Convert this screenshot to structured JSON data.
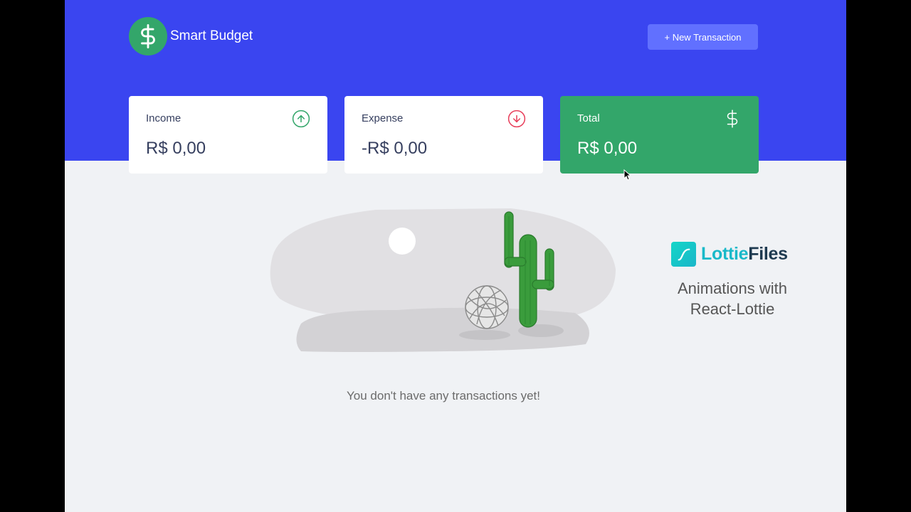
{
  "app": {
    "name": "Smart Budget",
    "logo_icon": "dollar-icon"
  },
  "header": {
    "new_transaction_label": "+ New Transaction"
  },
  "summary": {
    "income": {
      "label": "Income",
      "value": "R$ 0,00",
      "icon": "arrow-up-circle-icon",
      "color": "#33a66a"
    },
    "expense": {
      "label": "Expense",
      "value": "-R$ 0,00",
      "icon": "arrow-down-circle-icon",
      "color": "#e83f5b"
    },
    "total": {
      "label": "Total",
      "value": "R$ 0,00",
      "icon": "dollar-icon",
      "color": "#33a66a"
    }
  },
  "empty_state": {
    "message": "You don't have any transactions yet!",
    "illustration": "desert-cactus-illustration"
  },
  "overlay": {
    "brand_prefix": "Lottie",
    "brand_suffix": "Files",
    "tagline_line1": "Animations with",
    "tagline_line2": "React-Lottie"
  },
  "colors": {
    "primary": "#3a45f0",
    "accent": "#33a66a",
    "button": "#6170ff",
    "background": "#f0f2f5"
  }
}
